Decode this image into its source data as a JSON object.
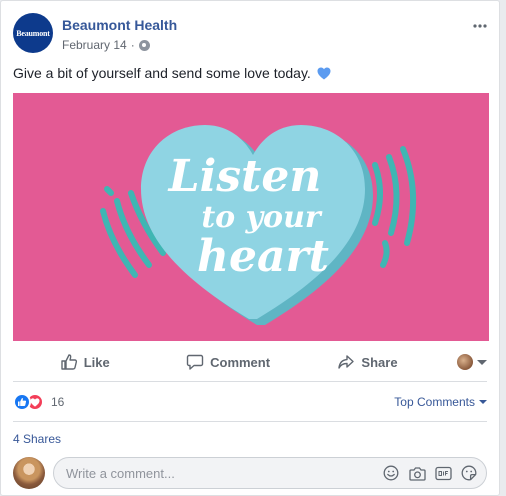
{
  "post": {
    "page_name": "Beaumont Health",
    "avatar_text": "Beaumont",
    "date": "February 14",
    "separator": "·",
    "privacy_icon": "globe-icon",
    "more_icon": "more-icon",
    "text": "Give a bit of yourself and send some love today.",
    "text_emoji": "blue-heart-icon"
  },
  "image": {
    "background_color": "#e35a94",
    "heart_color": "#8fd4e3",
    "heart_shadow_color": "#5fb5c4",
    "lines": [
      "Listen",
      "to your",
      "heart"
    ]
  },
  "actions": {
    "like_label": "Like",
    "comment_label": "Comment",
    "share_label": "Share"
  },
  "reactions": {
    "types": [
      "like",
      "love"
    ],
    "count": "16",
    "sort_label": "Top Comments"
  },
  "shares": {
    "label": "4 Shares"
  },
  "composer": {
    "placeholder": "Write a comment...",
    "tools": [
      "emoji-icon",
      "camera-icon",
      "gif-icon",
      "sticker-icon"
    ]
  },
  "colors": {
    "link": "#365899",
    "like_blue": "#1877f2",
    "love_red": "#f33e58",
    "muted": "#606770"
  }
}
